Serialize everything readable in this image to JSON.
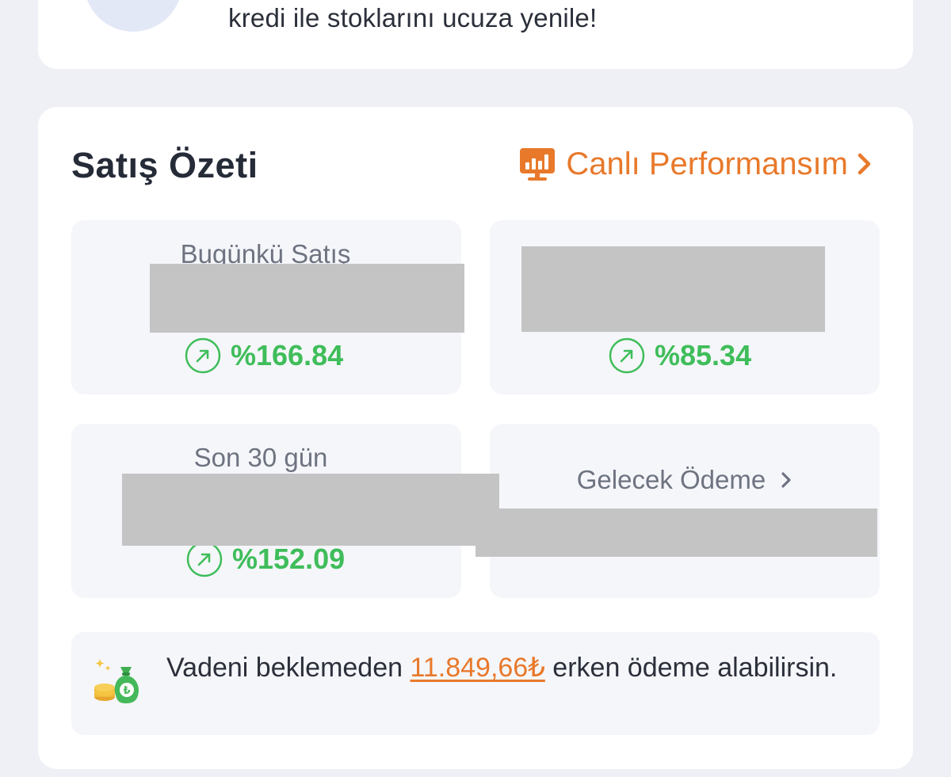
{
  "promo": {
    "text": "kredi ile stoklarını ucuza yenile!"
  },
  "summary": {
    "title": "Satış Özeti",
    "live_link_label": "Canlı Performansım"
  },
  "tiles": {
    "today": {
      "label": "Bugünkü Satış",
      "change": "%166.84"
    },
    "second": {
      "change": "%85.34"
    },
    "last30": {
      "label": "Son 30 gün",
      "change": "%152.09"
    },
    "future": {
      "label": "Gelecek Ödeme"
    }
  },
  "early_payment": {
    "text_before": "Vadeni beklemeden ",
    "amount": "11.849,66₺",
    "text_after": " erken ödeme alabilirsin."
  },
  "colors": {
    "accent_orange": "#e8792b",
    "positive_green": "#3fbd5a",
    "redaction_gray": "#c4c4c4"
  },
  "icons": {
    "live": "monitor-chart-icon",
    "change": "arrow-up-right-icon",
    "banner": "money-bag-icon"
  }
}
